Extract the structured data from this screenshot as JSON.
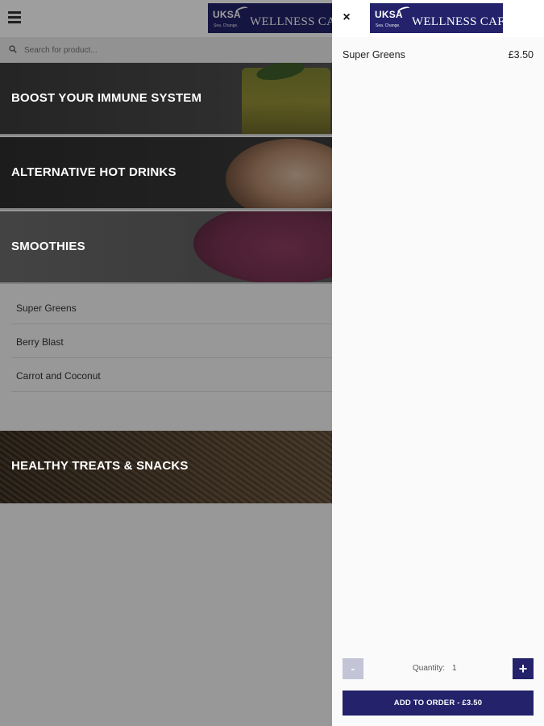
{
  "header": {
    "logo": {
      "org": "UKSA",
      "tagline": "Sea. Change.",
      "name": "WELLNESS CAFÉ"
    }
  },
  "search": {
    "placeholder": "Search for product..."
  },
  "categories": [
    {
      "label": "BOOST YOUR IMMUNE SYSTEM"
    },
    {
      "label": "ALTERNATIVE HOT DRINKS"
    },
    {
      "label": "SMOOTHIES"
    },
    {
      "label": "HEALTHY TREATS & SNACKS"
    }
  ],
  "smoothie_products": [
    {
      "name": "Super Greens"
    },
    {
      "name": "Berry Blast"
    },
    {
      "name": "Carrot and Coconut"
    }
  ],
  "drawer": {
    "close_glyph": "×",
    "item": {
      "name": "Super Greens",
      "price": "£3.50"
    },
    "quantity": {
      "label": "Quantity:",
      "value": "1",
      "minus": "-",
      "plus": "+"
    },
    "add_button": "ADD TO ORDER  -  £3.50"
  },
  "colors": {
    "brand": "#23226b",
    "disabled_button": "#c3c4d6"
  }
}
